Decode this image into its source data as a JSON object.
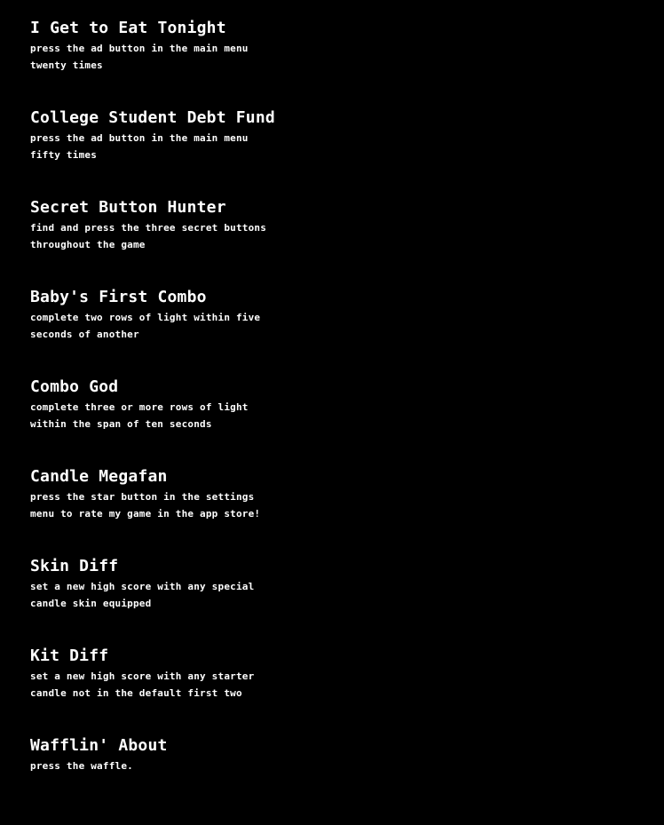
{
  "achievements": [
    {
      "title": "I Get to Eat Tonight",
      "description": "press the ad button in the main menu\ntwenty times"
    },
    {
      "title": "College Student Debt Fund",
      "description": "press the ad button in the main menu\nfifty times"
    },
    {
      "title": "Secret Button Hunter",
      "description": "find and press the three secret buttons\nthroughout the game"
    },
    {
      "title": "Baby's First Combo",
      "description": "complete two rows of light within five\nseconds of another"
    },
    {
      "title": "Combo God",
      "description": "complete three or more rows of light\nwithin the span of ten seconds"
    },
    {
      "title": "Candle Megafan",
      "description": "press the star button in the settings\nmenu to rate my game in the app store!"
    },
    {
      "title": "Skin Diff",
      "description": "set a new high score with any special\ncandle skin equipped"
    },
    {
      "title": "Kit Diff",
      "description": "set a new high score with any starter\ncandle not in the default first two"
    },
    {
      "title": "Wafflin' About",
      "description": "press the waffle."
    }
  ]
}
